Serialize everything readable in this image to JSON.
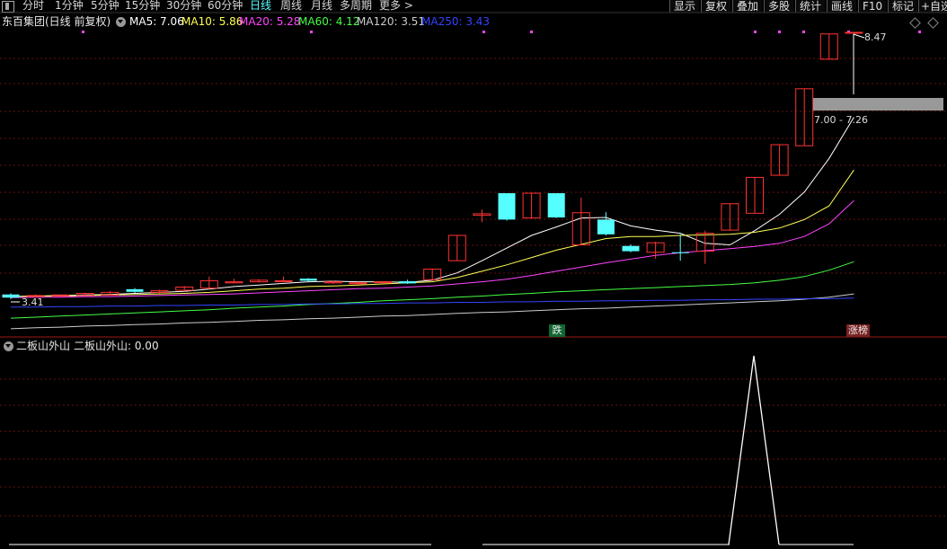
{
  "toolbar": {
    "tabs": [
      "分时",
      "1分钟",
      "5分钟",
      "15分钟",
      "30分钟",
      "60分钟",
      "日线",
      "周线",
      "月线",
      "多周期",
      "更多 >"
    ],
    "active_tab": "日线",
    "right": [
      "显示",
      "复权",
      "叠加",
      "多股",
      "统计",
      "画线",
      "F10",
      "标记",
      "+自选"
    ]
  },
  "main_header": {
    "title": "东百集团(日线 前复权)",
    "ma": [
      {
        "label": "MA5: 7.06",
        "color": "#ffffff"
      },
      {
        "label": "MA10: 5.86",
        "color": "#ffff55"
      },
      {
        "label": "MA20: 5.28",
        "color": "#ff44ff"
      },
      {
        "label": "MA60: 4.12",
        "color": "#44ff44"
      },
      {
        "label": "MA120: 3.51",
        "color": "#cccccc"
      },
      {
        "label": "MA250: 3.43",
        "color": "#3344ff"
      }
    ]
  },
  "annotations": {
    "high_price": "8.47",
    "low_price": "3.41",
    "range_box": "7.00 - 7.26",
    "marker_down": "跌",
    "marker_limit": "涨榜"
  },
  "sub_header": {
    "indicator": "二板山外山",
    "value_label": "二板山外山: 0.00"
  },
  "chart_data": {
    "type": "candlestick",
    "series_name": "东百集团(日线 前复权)",
    "low_price": 3.41,
    "high_price": 8.47,
    "candles": [
      {
        "o": 3.44,
        "c": 3.5,
        "h": 3.52,
        "l": 3.41,
        "up": false
      },
      {
        "o": 3.46,
        "c": 3.48,
        "h": 3.5,
        "l": 3.44,
        "up": true
      },
      {
        "o": 3.47,
        "c": 3.49,
        "h": 3.5,
        "l": 3.45,
        "up": true
      },
      {
        "o": 3.48,
        "c": 3.52,
        "h": 3.53,
        "l": 3.47,
        "up": true
      },
      {
        "o": 3.49,
        "c": 3.54,
        "h": 3.56,
        "l": 3.48,
        "up": true
      },
      {
        "o": 3.55,
        "c": 3.6,
        "h": 3.62,
        "l": 3.53,
        "up": false
      },
      {
        "o": 3.54,
        "c": 3.57,
        "h": 3.59,
        "l": 3.52,
        "up": true
      },
      {
        "o": 3.58,
        "c": 3.64,
        "h": 3.66,
        "l": 3.56,
        "up": true
      },
      {
        "o": 3.62,
        "c": 3.76,
        "h": 3.84,
        "l": 3.6,
        "up": true
      },
      {
        "o": 3.72,
        "c": 3.74,
        "h": 3.8,
        "l": 3.71,
        "up": true
      },
      {
        "o": 3.74,
        "c": 3.77,
        "h": 3.79,
        "l": 3.73,
        "up": true
      },
      {
        "o": 3.75,
        "c": 3.76,
        "h": 3.84,
        "l": 3.75,
        "up": true
      },
      {
        "o": 3.8,
        "c": 3.76,
        "h": 3.81,
        "l": 3.74,
        "up": false
      },
      {
        "o": 3.72,
        "c": 3.74,
        "h": 3.76,
        "l": 3.7,
        "up": true
      },
      {
        "o": 3.71,
        "c": 3.72,
        "h": 3.74,
        "l": 3.69,
        "up": true
      },
      {
        "o": 3.73,
        "c": 3.74,
        "h": 3.75,
        "l": 3.72,
        "up": true
      },
      {
        "o": 3.75,
        "c": 3.71,
        "h": 3.78,
        "l": 3.7,
        "up": false
      },
      {
        "o": 3.78,
        "c": 3.98,
        "h": 3.99,
        "l": 3.78,
        "up": true
      },
      {
        "o": 4.14,
        "c": 4.62,
        "h": 4.62,
        "l": 4.14,
        "up": true
      },
      {
        "o": 5.0,
        "c": 5.03,
        "h": 5.11,
        "l": 4.87,
        "up": true
      },
      {
        "o": 5.42,
        "c": 4.92,
        "h": 5.42,
        "l": 4.9,
        "up": false
      },
      {
        "o": 4.95,
        "c": 5.42,
        "h": 5.42,
        "l": 4.94,
        "up": true
      },
      {
        "o": 5.42,
        "c": 4.96,
        "h": 5.42,
        "l": 4.95,
        "up": false
      },
      {
        "o": 5.05,
        "c": 4.44,
        "h": 5.34,
        "l": 4.44,
        "up": true
      },
      {
        "o": 4.92,
        "c": 4.64,
        "h": 5.06,
        "l": 4.62,
        "up": false
      },
      {
        "o": 4.42,
        "c": 4.32,
        "h": 4.45,
        "l": 4.3,
        "up": false
      },
      {
        "o": 4.3,
        "c": 4.48,
        "h": 4.5,
        "l": 4.18,
        "up": true
      },
      {
        "o": 4.3,
        "c": 4.3,
        "h": 4.64,
        "l": 4.14,
        "up": false
      },
      {
        "o": 4.32,
        "c": 4.66,
        "h": 4.71,
        "l": 4.08,
        "up": true
      },
      {
        "o": 4.72,
        "c": 5.22,
        "h": 5.22,
        "l": 4.72,
        "up": true
      },
      {
        "o": 5.04,
        "c": 5.72,
        "h": 5.72,
        "l": 5.04,
        "up": true
      },
      {
        "o": 5.76,
        "c": 6.34,
        "h": 6.34,
        "l": 5.76,
        "up": true
      },
      {
        "o": 6.32,
        "c": 7.4,
        "h": 7.4,
        "l": 6.32,
        "up": true
      },
      {
        "o": 7.96,
        "c": 8.44,
        "h": 8.44,
        "l": 7.96,
        "up": true
      },
      {
        "o": 8.47,
        "c": 8.47,
        "h": 8.47,
        "l": 8.47,
        "up": true
      }
    ],
    "ma_lines": [
      {
        "name": "MA5",
        "color": "#ffffff",
        "values": [
          3.46,
          3.47,
          3.48,
          3.49,
          3.5,
          3.52,
          3.54,
          3.56,
          3.6,
          3.65,
          3.68,
          3.71,
          3.74,
          3.75,
          3.74,
          3.74,
          3.73,
          3.77,
          3.91,
          4.14,
          4.38,
          4.62,
          4.78,
          4.95,
          4.96,
          4.8,
          4.72,
          4.66,
          4.47,
          4.44,
          4.71,
          5.02,
          5.44,
          6.08,
          6.86
        ]
      },
      {
        "name": "MA10",
        "color": "#ffff55",
        "values": [
          3.46,
          3.47,
          3.47,
          3.48,
          3.49,
          3.5,
          3.51,
          3.52,
          3.54,
          3.57,
          3.6,
          3.62,
          3.65,
          3.66,
          3.68,
          3.7,
          3.72,
          3.74,
          3.82,
          3.94,
          4.06,
          4.2,
          4.34,
          4.45,
          4.56,
          4.6,
          4.6,
          4.62,
          4.63,
          4.64,
          4.68,
          4.76,
          4.92,
          5.18,
          5.86
        ]
      },
      {
        "name": "MA20",
        "color": "#ff44ff",
        "values": [
          3.44,
          3.45,
          3.45,
          3.46,
          3.46,
          3.47,
          3.48,
          3.49,
          3.5,
          3.51,
          3.53,
          3.55,
          3.57,
          3.59,
          3.61,
          3.62,
          3.64,
          3.66,
          3.7,
          3.74,
          3.79,
          3.86,
          3.94,
          4.02,
          4.1,
          4.17,
          4.24,
          4.29,
          4.33,
          4.37,
          4.41,
          4.47,
          4.6,
          4.84,
          5.28
        ]
      },
      {
        "name": "MA60",
        "color": "#44ff44",
        "values": [
          3.05,
          3.07,
          3.09,
          3.11,
          3.13,
          3.15,
          3.17,
          3.19,
          3.21,
          3.24,
          3.26,
          3.28,
          3.31,
          3.33,
          3.35,
          3.38,
          3.4,
          3.42,
          3.45,
          3.47,
          3.5,
          3.52,
          3.55,
          3.57,
          3.59,
          3.61,
          3.63,
          3.65,
          3.67,
          3.69,
          3.72,
          3.77,
          3.84,
          3.96,
          4.12
        ]
      },
      {
        "name": "MA120",
        "color": "#cccccc",
        "values": [
          2.85,
          2.87,
          2.88,
          2.9,
          2.91,
          2.93,
          2.94,
          2.96,
          2.97,
          2.99,
          3.01,
          3.02,
          3.04,
          3.05,
          3.07,
          3.09,
          3.1,
          3.12,
          3.14,
          3.16,
          3.17,
          3.19,
          3.21,
          3.23,
          3.24,
          3.26,
          3.28,
          3.3,
          3.32,
          3.34,
          3.36,
          3.38,
          3.41,
          3.45,
          3.51
        ]
      },
      {
        "name": "MA250",
        "color": "#3344ff",
        "values": [
          3.26,
          3.26,
          3.27,
          3.27,
          3.28,
          3.28,
          3.29,
          3.29,
          3.3,
          3.3,
          3.31,
          3.31,
          3.32,
          3.32,
          3.33,
          3.33,
          3.34,
          3.34,
          3.35,
          3.35,
          3.36,
          3.36,
          3.37,
          3.37,
          3.38,
          3.38,
          3.39,
          3.39,
          3.4,
          3.4,
          3.41,
          3.41,
          3.42,
          3.42,
          3.43
        ]
      }
    ],
    "indicator": {
      "name": "二板山外山",
      "values": [
        0,
        0,
        0,
        0,
        0,
        0,
        0,
        0,
        0,
        0,
        0,
        0,
        0,
        0,
        0,
        0,
        0,
        0,
        0,
        0,
        0,
        0,
        0,
        0,
        0,
        0,
        0,
        0,
        0,
        0,
        1,
        0,
        0,
        0,
        0
      ]
    }
  }
}
